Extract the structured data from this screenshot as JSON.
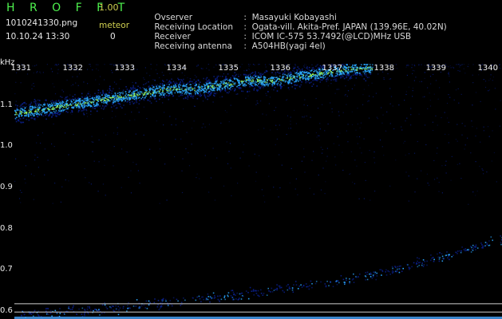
{
  "header": {
    "logo": "H R O F F T",
    "version": "1.00",
    "filename": "1010241330.png",
    "datetime": "10.10.24 13:30",
    "meteor_label": "meteor",
    "meteor_count": "0"
  },
  "info": {
    "observer": {
      "key": "Ovserver",
      "sep": ":",
      "value": "Masayuki Kobayashi"
    },
    "location": {
      "key": "Receiving Location",
      "sep": ":",
      "value": "Ogata-vill. Akita-Pref. JAPAN (139.96E, 40.02N)"
    },
    "receiver": {
      "key": "Receiver",
      "sep": ":",
      "value": "ICOM IC-575 53.7492(@LCD)MHz USB"
    },
    "antenna": {
      "key": "Receiving antenna",
      "sep": ":",
      "value": "A504HB(yagi 4el)"
    }
  },
  "chart_data": {
    "type": "heatmap",
    "unit_label": "kHz",
    "x_ticks": [
      "1331",
      "1332",
      "1333",
      "1334",
      "1335",
      "1336",
      "1337",
      "1338",
      "1339",
      "1340"
    ],
    "y_ticks": [
      "1.1",
      "1.0",
      "0.9",
      "0.8",
      "0.7",
      "0.6"
    ],
    "xlim": [
      1330.7,
      1340.1
    ],
    "ylim": [
      0.58,
      1.2
    ],
    "horizontal_lines": [
      0.617,
      0.597
    ],
    "traces": [
      {
        "name": "",
        "points": [
          [
            1330.7,
            1.08
          ],
          [
            1331.2,
            1.09
          ],
          [
            1331.7,
            1.1
          ],
          [
            1332.2,
            1.11
          ],
          [
            1332.7,
            1.12
          ],
          [
            1333.2,
            1.13
          ],
          [
            1333.7,
            1.14
          ],
          [
            1334.2,
            1.14
          ],
          [
            1334.7,
            1.15
          ],
          [
            1335.2,
            1.16
          ],
          [
            1335.7,
            1.16
          ],
          [
            1336.2,
            1.17
          ],
          [
            1336.7,
            1.18
          ],
          [
            1337.2,
            1.19
          ],
          [
            1337.6,
            1.19
          ]
        ],
        "intensity": 1.0
      },
      {
        "name": "",
        "points": [
          [
            1330.8,
            0.595
          ],
          [
            1332.0,
            0.6
          ],
          [
            1333.0,
            0.612
          ],
          [
            1334.0,
            0.625
          ],
          [
            1335.0,
            0.64
          ],
          [
            1336.0,
            0.655
          ],
          [
            1337.0,
            0.675
          ],
          [
            1338.0,
            0.7
          ],
          [
            1339.0,
            0.735
          ],
          [
            1340.1,
            0.775
          ]
        ],
        "intensity": 0.35
      }
    ],
    "colors": {
      "background": "#000000",
      "low": "#0a1f8a",
      "mid": "#2aa7ff",
      "high": "#9cff60",
      "hline": "#cfcfcf",
      "baseline": "#4aa8ff"
    }
  }
}
